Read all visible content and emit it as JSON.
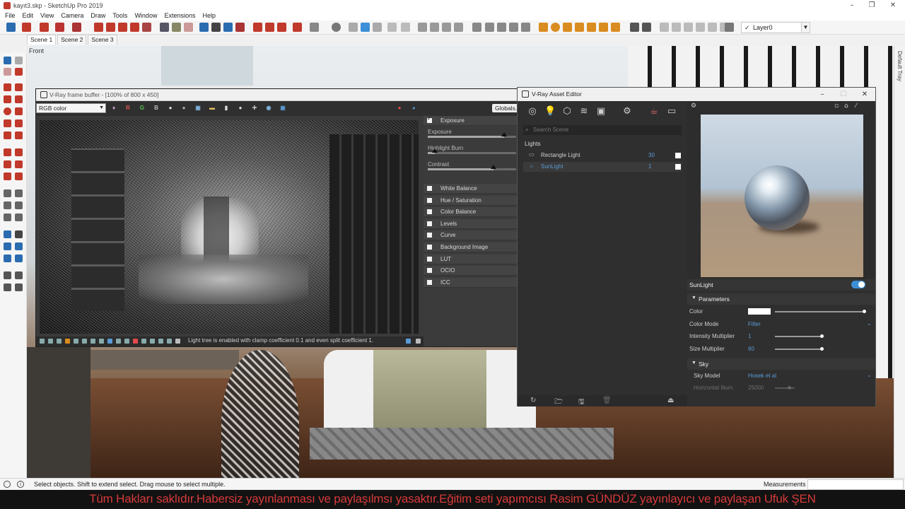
{
  "window": {
    "title": "kayıt3.skp - SketchUp Pro 2019"
  },
  "menubar": [
    "File",
    "Edit",
    "View",
    "Camera",
    "Draw",
    "Tools",
    "Window",
    "Extensions",
    "Help"
  ],
  "toolbar": {
    "layer": "Layer0"
  },
  "scenes": [
    "Scene 1",
    "Scene 2",
    "Scene 3"
  ],
  "viewport": {
    "label": "Front"
  },
  "tray": {
    "label": "Default Tray"
  },
  "vfb": {
    "title": "V-Ray frame buffer - [100% of 800 x 450]",
    "channel": "RGB color",
    "buttons": {
      "r": "R",
      "g": "G",
      "b": "B"
    },
    "globals_label": "Globals...",
    "status_message": "Light tree is enabled with clamp coefficient 0.1 and even split coefficient 1.",
    "exposure": {
      "label": "Exposure",
      "checked": true,
      "sliders": [
        {
          "label": "Exposure",
          "level": 0.86
        },
        {
          "label": "Highlight Burn",
          "level": 0.08
        },
        {
          "label": "Contrast",
          "level": 0.74
        }
      ]
    },
    "corrections": [
      "White Balance",
      "Hue / Saturation",
      "Color Balance",
      "Levels",
      "Curve",
      "Background Image",
      "LUT",
      "OCIO",
      "ICC"
    ]
  },
  "asset_editor": {
    "title": "V-Ray Asset Editor",
    "search_placeholder": "Search Scene",
    "section": "Lights",
    "lights": [
      {
        "name": "Rectangle Light",
        "value": "30",
        "enabled": true,
        "selected": false
      },
      {
        "name": "SunLight",
        "value": "1",
        "enabled": true,
        "selected": true
      }
    ],
    "selected_object": "SunLight",
    "toggle_on": true,
    "parameters": {
      "group": "Parameters",
      "color_label": "Color",
      "color_swatch": "#ffffff",
      "color_mode_label": "Color Mode",
      "color_mode": "Filter",
      "intensity_label": "Intensity Multiplier",
      "intensity": "1",
      "intensity_level": 0.97,
      "size_label": "Size Multiplier",
      "size": "60",
      "size_level": 0.97
    },
    "sky": {
      "group": "Sky",
      "model_label": "Sky Model",
      "model": "Hosek et al",
      "horizon_label": "Horizontal Illum.",
      "horizon": "25000"
    }
  },
  "statusbar": {
    "message": "Select objects. Shift to extend select. Drag mouse to select multiple.",
    "measurements_label": "Measurements"
  },
  "credits": "Tüm Hakları saklıdır.Habersiz yayınlanması ve paylaşılmsı yasaktır.Eğitim seti yapımcısı Rasim GÜNDÜZ  yayınlayıcı ve paylaşan Ufuk ŞEN",
  "colors": {
    "accent": "#3d8fd8",
    "value_blue": "#5b9bd5",
    "credit_red": "#d73a3a"
  }
}
